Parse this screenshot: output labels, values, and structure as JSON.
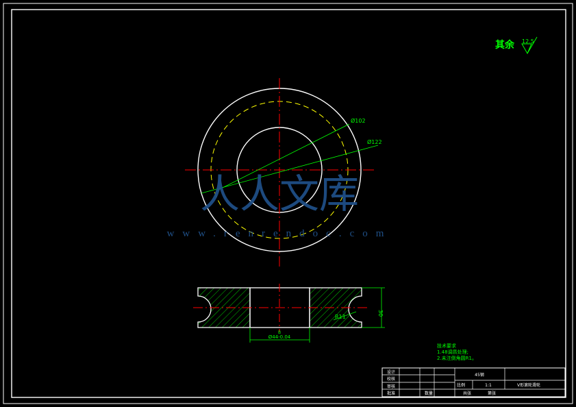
{
  "surface_finish": {
    "label": "其余",
    "value": "12.5"
  },
  "dimensions": {
    "d_outer_circle": "Ø122",
    "d_pitch_circle": "Ø102",
    "bore_diameter": "Ø44-0.04",
    "bore_fit": "B",
    "groove_radius": "R11",
    "width": "30"
  },
  "watermark": {
    "text_main": "人人文库",
    "url": "www.renrendoc.com"
  },
  "tech_requirements": {
    "title": "技术要求",
    "items": [
      "1.48调质处理;",
      "2.未注倒角圆R1。"
    ]
  },
  "title_block": {
    "material": "45钢",
    "label_scale": "比例",
    "scale": "1:1",
    "part_name": "V形滚轮滑轮",
    "rows": [
      "设计",
      "校核",
      "审核",
      "批准"
    ],
    "total_label": "共张",
    "sheet_label": "第张",
    "count_label": "数量"
  },
  "colors": {
    "background": "#000000",
    "outline": "#ffffff",
    "centerline": "#ff0000",
    "dimension": "#00ff00",
    "hatch": "#00ff00",
    "hidden_circle": "#ffff00",
    "watermark": "#1f4f86"
  }
}
